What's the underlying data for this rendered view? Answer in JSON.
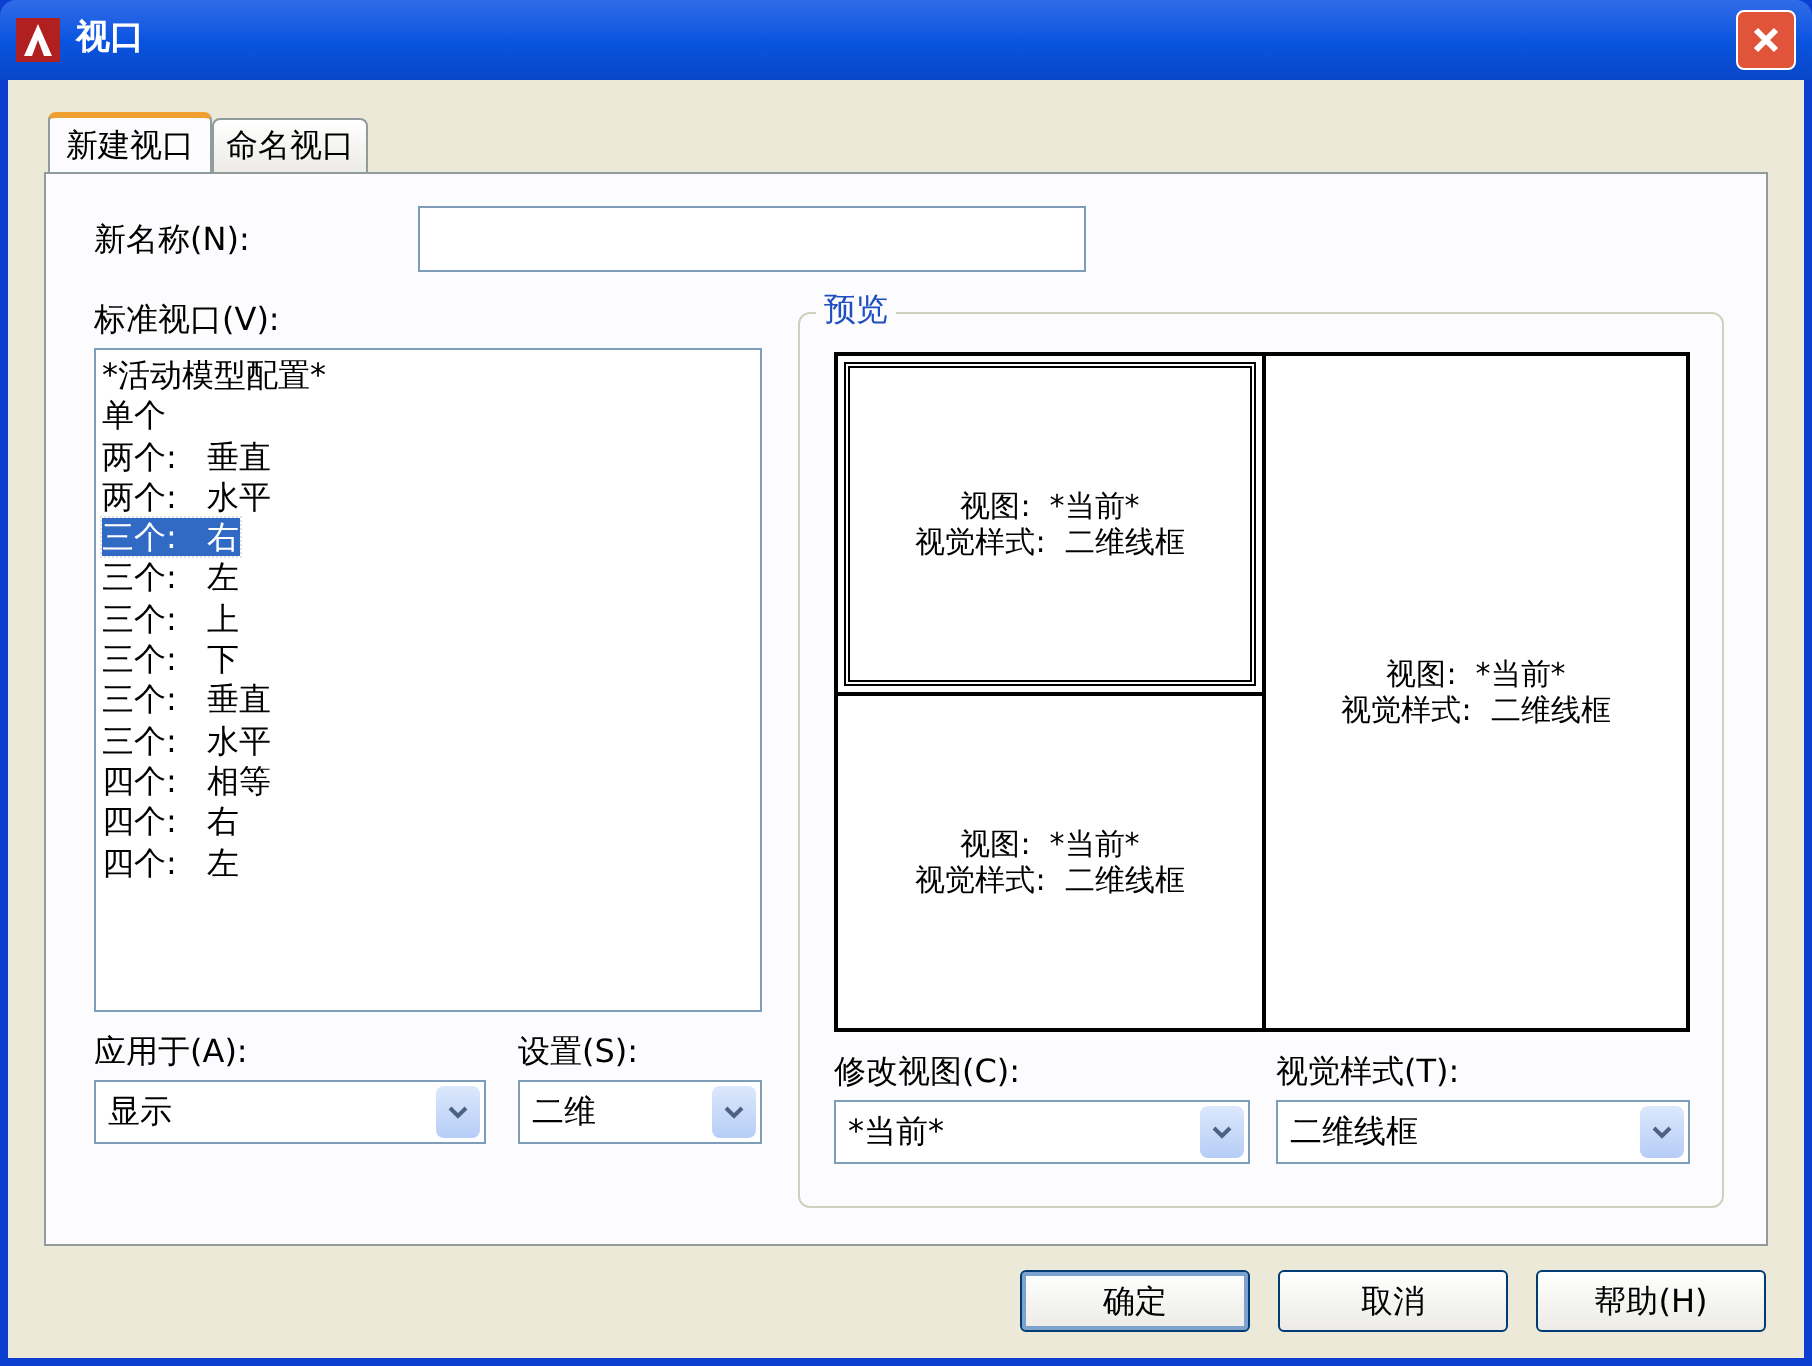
{
  "window": {
    "title": "视口"
  },
  "tabs": [
    {
      "label": "新建视口",
      "selected": true
    },
    {
      "label": "命名视口",
      "selected": false
    }
  ],
  "new_name": {
    "label": "新名称(N):"
  },
  "standard_viewports": {
    "label": "标准视口(V):",
    "items": [
      {
        "label": "*活动模型配置*",
        "selected": false
      },
      {
        "label": "单个",
        "selected": false
      },
      {
        "label": "两个:   垂直",
        "selected": false
      },
      {
        "label": "两个:   水平",
        "selected": false
      },
      {
        "label": "三个:   右",
        "selected": true
      },
      {
        "label": "三个:   左",
        "selected": false
      },
      {
        "label": "三个:   上",
        "selected": false
      },
      {
        "label": "三个:   下",
        "selected": false
      },
      {
        "label": "三个:   垂直",
        "selected": false
      },
      {
        "label": "三个:   水平",
        "selected": false
      },
      {
        "label": "四个:   相等",
        "selected": false
      },
      {
        "label": "四个:   右",
        "selected": false
      },
      {
        "label": "四个:   左",
        "selected": false
      }
    ]
  },
  "apply_to": {
    "label": "应用于(A):",
    "value": "显示"
  },
  "setup": {
    "label": "设置(S):",
    "value": "二维"
  },
  "preview": {
    "title": "预览",
    "viewports": [
      {
        "view": "视图:  *当前*",
        "style": "视觉样式:  二维线框",
        "active": true
      },
      {
        "view": "视图:  *当前*",
        "style": "视觉样式:  二维线框",
        "active": false
      },
      {
        "view": "视图:  *当前*",
        "style": "视觉样式:  二维线框",
        "active": false
      }
    ]
  },
  "change_view": {
    "label": "修改视图(C):",
    "value": "*当前*"
  },
  "visual_style": {
    "label": "视觉样式(T):",
    "value": "二维线框"
  },
  "buttons": [
    {
      "label": "确定",
      "default": true
    },
    {
      "label": "取消",
      "default": false
    },
    {
      "label": "帮助(H)",
      "default": false
    }
  ]
}
